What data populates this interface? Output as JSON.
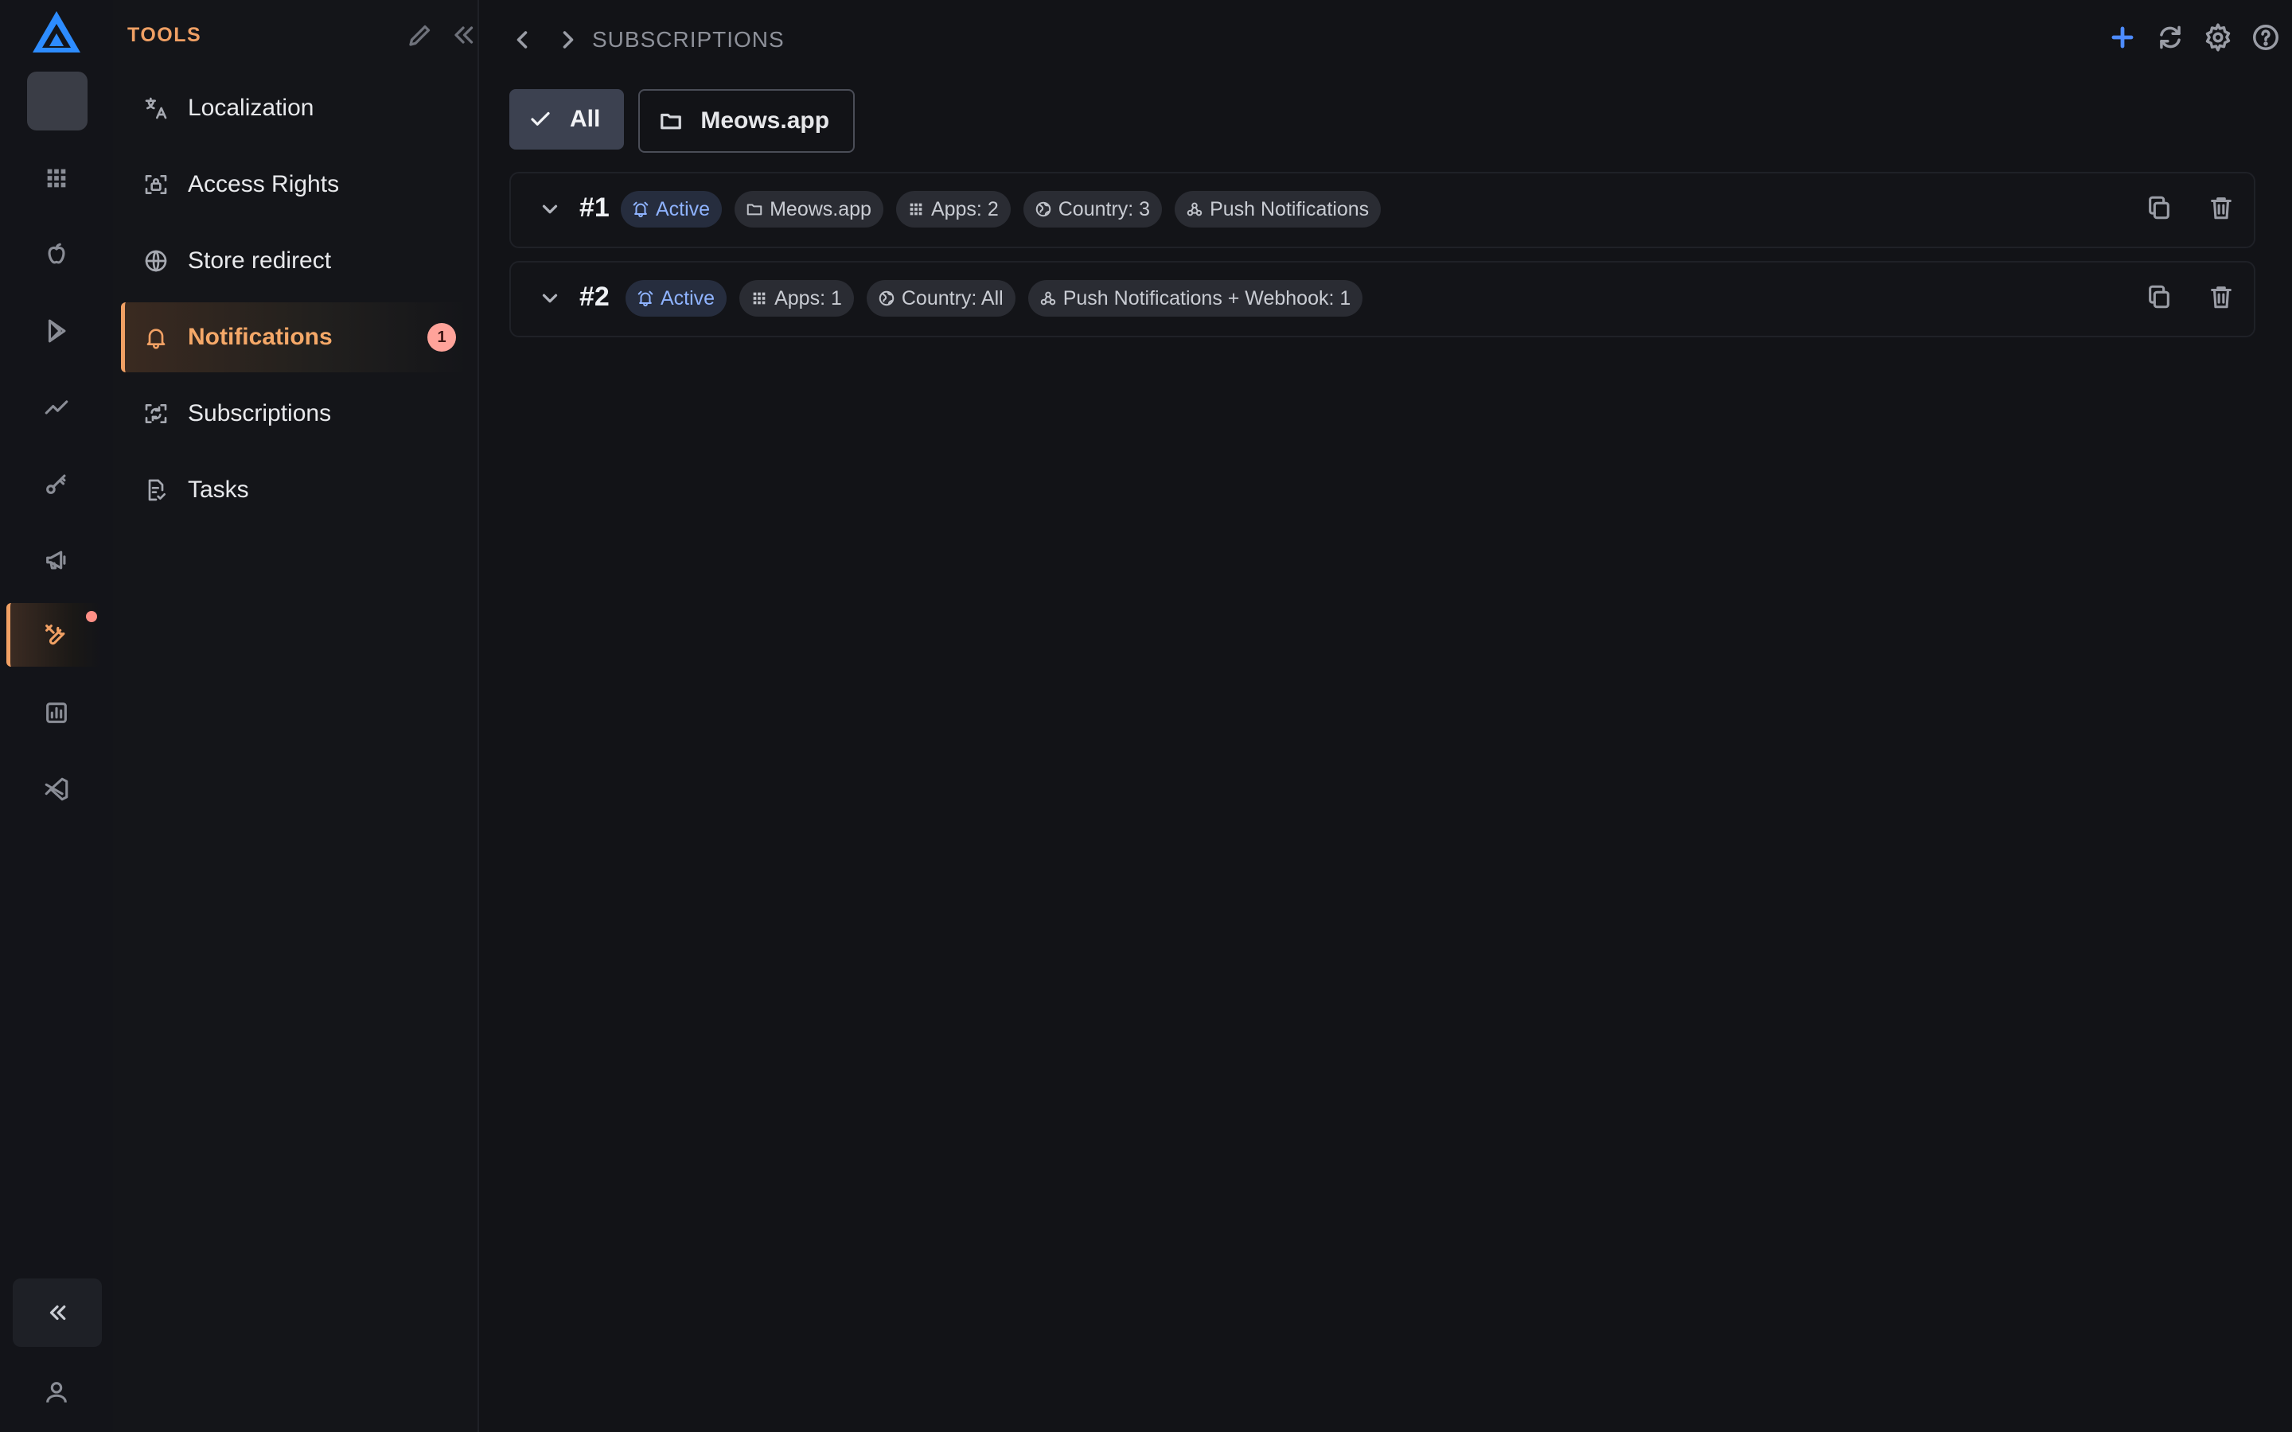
{
  "panel": {
    "title": "TOOLS",
    "items": [
      {
        "label": "Localization",
        "icon": "translate-icon"
      },
      {
        "label": "Access Rights",
        "icon": "access-rights-icon"
      },
      {
        "label": "Store redirect",
        "icon": "globe-icon"
      },
      {
        "label": "Notifications",
        "icon": "bell-icon",
        "badge": "1",
        "active": true
      },
      {
        "label": "Subscriptions",
        "icon": "subscriptions-icon"
      },
      {
        "label": "Tasks",
        "icon": "tasks-icon"
      }
    ]
  },
  "header": {
    "breadcrumb": "SUBSCRIPTIONS"
  },
  "filters": {
    "all_label": "All",
    "folder_label": "Meows.app"
  },
  "subscriptions": [
    {
      "number": "#1",
      "status": "Active",
      "project": "Meows.app",
      "apps": "Apps: 2",
      "country": "Country: 3",
      "channel": "Push Notifications"
    },
    {
      "number": "#2",
      "status": "Active",
      "apps": "Apps: 1",
      "country": "Country: All",
      "channel": "Push Notifications + Webhook: 1"
    }
  ],
  "colors": {
    "accent": "#f0a064",
    "brand": "#2d8cff",
    "add": "#4d8bff",
    "active_tag": "#8fb3ff",
    "badge": "#ffa39a"
  }
}
